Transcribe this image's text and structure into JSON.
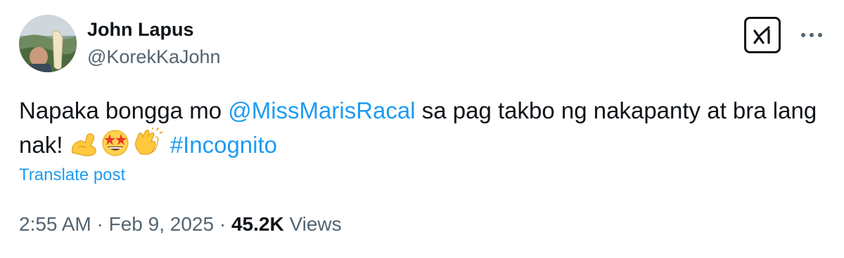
{
  "author": {
    "name": "John Lapus",
    "handle": "@KorekKaJohn",
    "avatar_icon": "profile-photo"
  },
  "actions": {
    "grok_icon": "grok-icon",
    "more_icon": "more-horizontal-icon"
  },
  "post": {
    "text_before": "Napaka bongga mo ",
    "mention": "@MissMarisRacal",
    "text_after": " sa pag takbo ng nakapanty at bra lang nak! ",
    "emojis": [
      "flexed-biceps-emoji",
      "star-struck-emoji",
      "clapping-hands-emoji"
    ],
    "hashtag": "#Incognito"
  },
  "translate_label": "Translate post",
  "meta": {
    "time": "2:55 AM",
    "separator": " · ",
    "date": "Feb 9, 2025",
    "views_count": "45.2K",
    "views_label": " Views"
  },
  "colors": {
    "link": "#1d9bf0",
    "text": "#0f1419",
    "secondary": "#536471"
  }
}
